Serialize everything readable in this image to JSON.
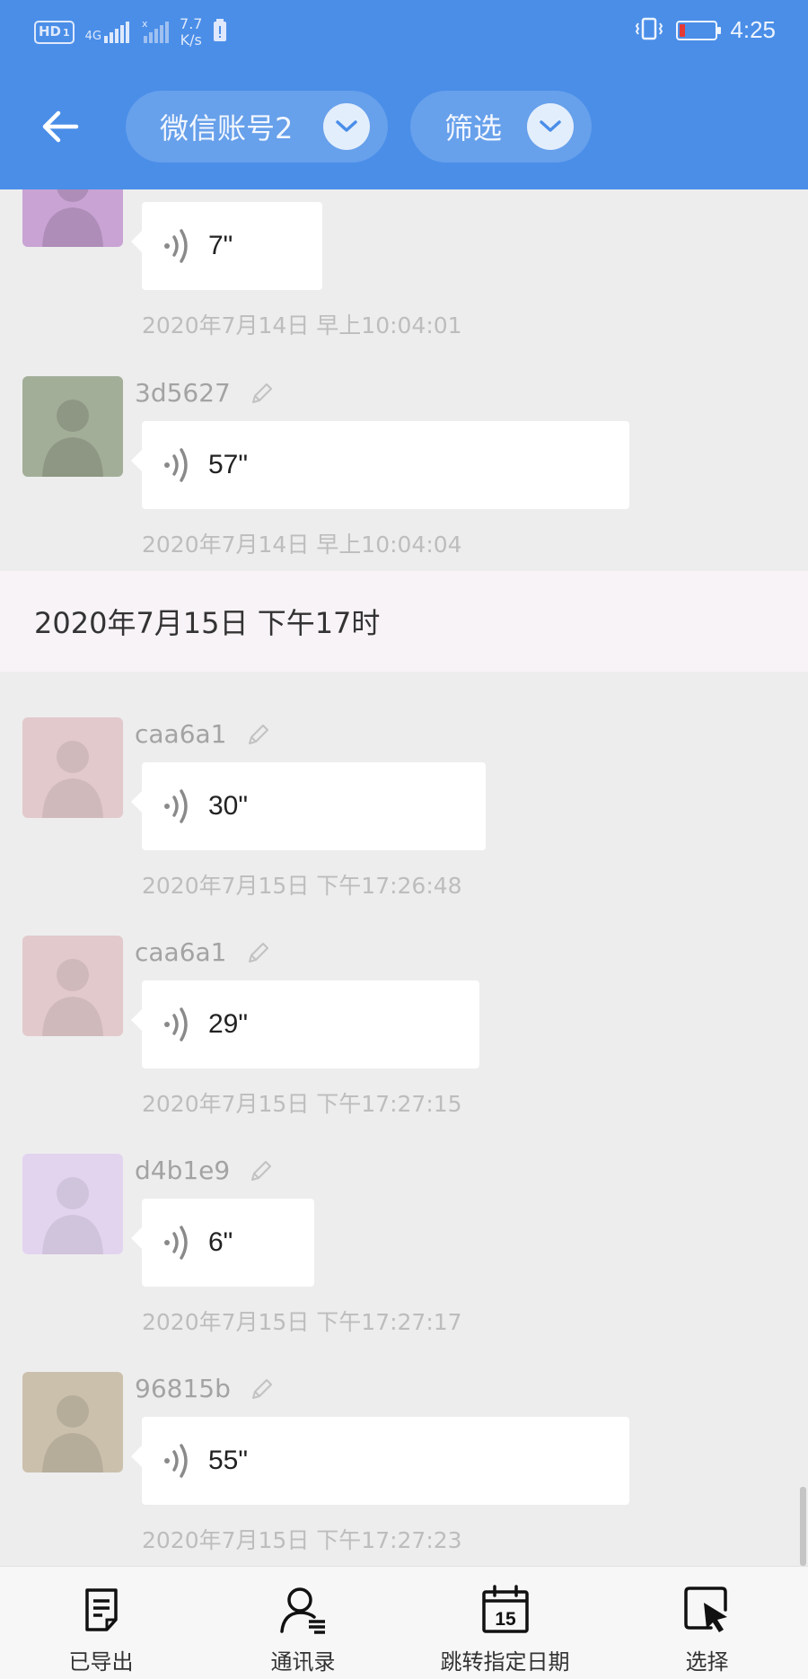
{
  "status_bar": {
    "hd_label": "HD",
    "sim_index": "1",
    "network": "4G",
    "speed_value": "7.7",
    "speed_unit": "K/s",
    "time": "4:25",
    "battery_level": 0.1
  },
  "header": {
    "account_label": "微信账号2",
    "filter_label": "筛选",
    "background_color": "#4a8ee8"
  },
  "messages_top": [
    {
      "sender": "",
      "duration": "7\"",
      "timestamp": "2020年7月14日 早上10:04:01",
      "avatar_color": "#c8a3d4"
    },
    {
      "sender": "3d5627",
      "duration": "57\"",
      "timestamp": "2020年7月14日 早上10:04:04",
      "avatar_color": "#a3ae98"
    }
  ],
  "date_separator": "2020年7月15日 下午17时",
  "messages_bottom": [
    {
      "sender": "caa6a1",
      "duration": "30\"",
      "timestamp": "2020年7月15日 下午17:26:48",
      "avatar_color": "#e2c9cb"
    },
    {
      "sender": "caa6a1",
      "duration": "29\"",
      "timestamp": "2020年7月15日 下午17:27:15",
      "avatar_color": "#e2c9cb"
    },
    {
      "sender": "d4b1e9",
      "duration": "6\"",
      "timestamp": "2020年7月15日 下午17:27:17",
      "avatar_color": "#e2d4ef"
    },
    {
      "sender": "96815b",
      "duration": "55\"",
      "timestamp": "2020年7月15日 下午17:27:23",
      "avatar_color": "#cbc0ac"
    }
  ],
  "bottom_bar": {
    "exported": "已导出",
    "contacts": "通讯录",
    "jump_date": "跳转指定日期",
    "jump_date_day": "15",
    "select": "选择"
  }
}
